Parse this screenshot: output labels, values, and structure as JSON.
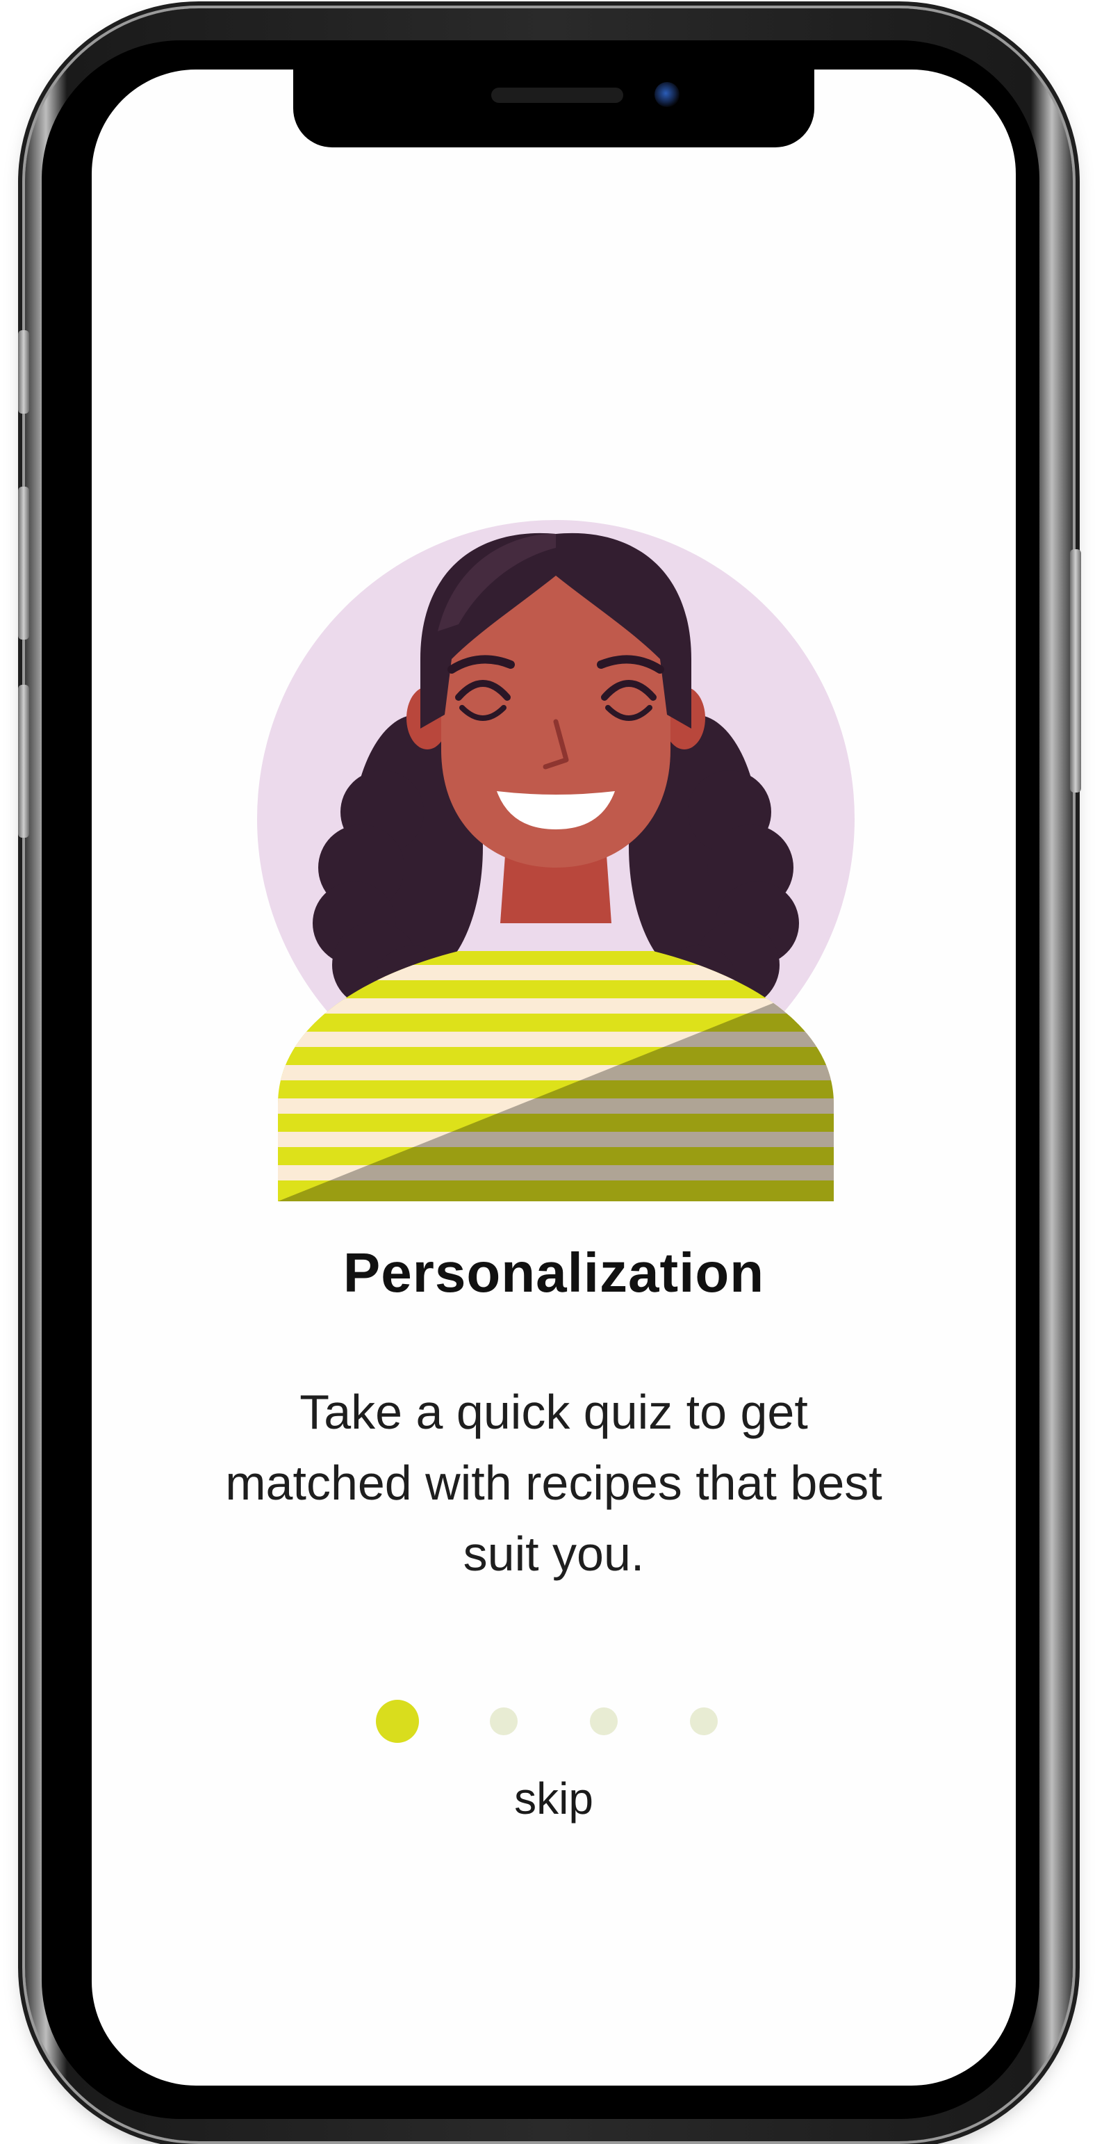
{
  "onboarding": {
    "title": "Personalization",
    "description": "Take a quick quiz to get matched with recipes that best suit you.",
    "skip_label": "skip",
    "pagination": {
      "total_pages": 4,
      "current_page": 1
    },
    "illustration_icon": "smiling-woman-avatar"
  },
  "colors": {
    "accent": "#d9dd1d",
    "dot_inactive": "#e8ecd3",
    "avatar_circle": "#ecdaec",
    "hair": "#331e30",
    "skin": "#c05a4c",
    "shirt_stripe_yellow": "#dde11a",
    "shirt_stripe_cream": "#fbebd6",
    "text_primary": "#111111"
  }
}
